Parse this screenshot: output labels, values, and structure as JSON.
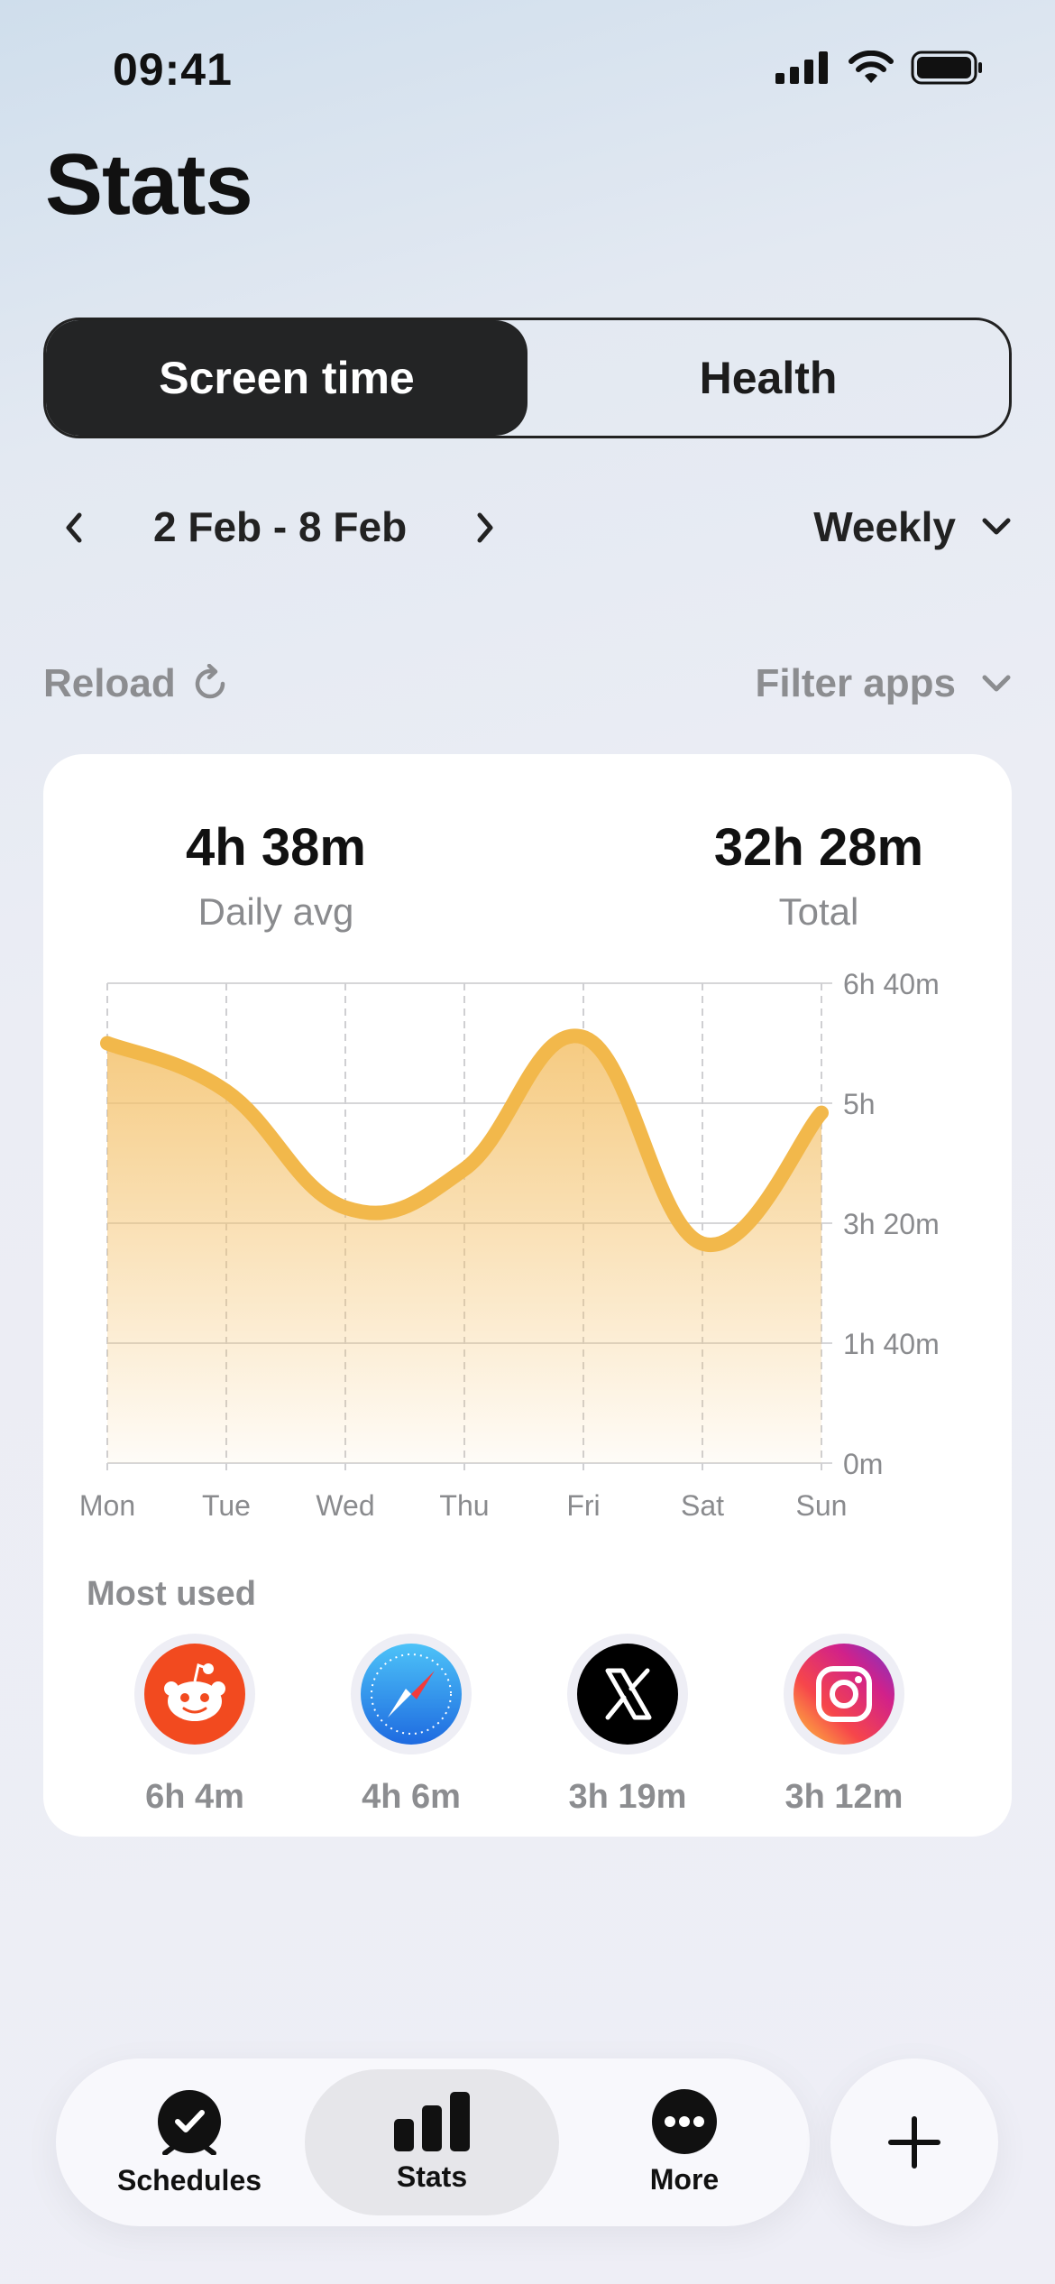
{
  "status_bar": {
    "time": "09:41"
  },
  "page": {
    "title": "Stats"
  },
  "segment": {
    "options": [
      "Screen time",
      "Health"
    ],
    "selected": "Screen time"
  },
  "date_nav": {
    "range": "2 Feb - 8 Feb",
    "period": "Weekly"
  },
  "tools": {
    "reload_label": "Reload",
    "filter_label": "Filter apps"
  },
  "summary": {
    "daily_avg_value": "4h 38m",
    "daily_avg_label": "Daily avg",
    "total_value": "32h 28m",
    "total_label": "Total"
  },
  "chart_data": {
    "type": "area",
    "categories": [
      "Mon",
      "Tue",
      "Wed",
      "Thu",
      "Fri",
      "Sat",
      "Sun"
    ],
    "series": [
      {
        "values_minutes": [
          350,
          310,
          213,
          245,
          355,
          183,
          292
        ]
      }
    ],
    "y_ticks": [
      "6h 40m",
      "5h",
      "3h 20m",
      "1h 40m",
      "0m"
    ],
    "ylim": [
      0,
      400
    ],
    "grid": true,
    "color": "#F2B84B"
  },
  "most_used": {
    "label": "Most used",
    "apps": [
      {
        "icon": "reddit-icon",
        "time": "6h 4m"
      },
      {
        "icon": "safari-icon",
        "time": "4h 6m"
      },
      {
        "icon": "x-icon",
        "time": "3h 19m"
      },
      {
        "icon": "instagram-icon",
        "time": "3h 12m"
      }
    ]
  },
  "tabbar": {
    "items": [
      {
        "label": "Schedules",
        "icon": "clock-check-icon"
      },
      {
        "label": "Stats",
        "icon": "bar-chart-icon",
        "active": true
      },
      {
        "label": "More",
        "icon": "more-icon"
      }
    ],
    "fab_icon": "plus-icon"
  }
}
